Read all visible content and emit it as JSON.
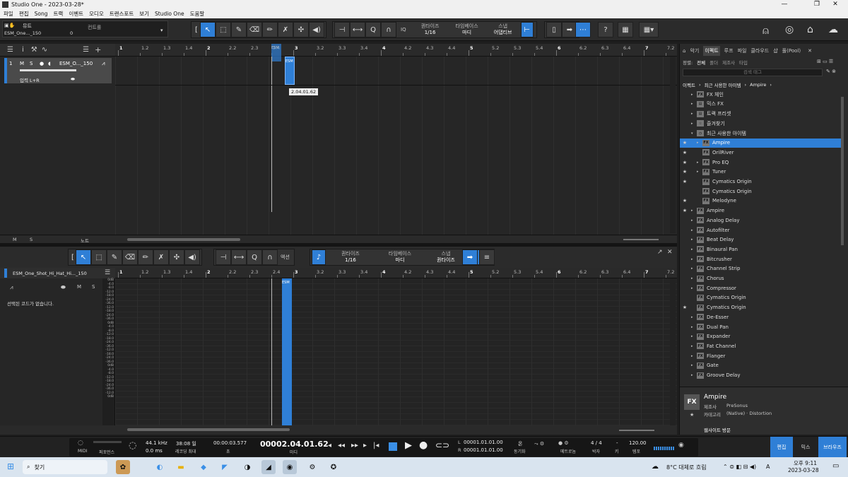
{
  "window": {
    "title": "Studio One - 2023-03-28*",
    "min": "—",
    "max": "❐",
    "close": "✕"
  },
  "menu": [
    "파일",
    "편집",
    "Song",
    "트랙",
    "이벤트",
    "오디오",
    "트랜스포트",
    "보기",
    "Studio One",
    "도움말"
  ],
  "toolbar": {
    "mute_label": "뮤트",
    "track_name": "ESM_One..._150",
    "vol": "0",
    "control_label": "컨트롤",
    "iq": "IQ",
    "quantize_label": "퀀타이즈",
    "quantize_val": "1/16",
    "timebase_label": "타임베이스",
    "timebase_val": "마디",
    "snap_label": "스냅",
    "snap_val": "어댑티브",
    "help": "?"
  },
  "track": {
    "num": "1",
    "m": "M",
    "s": "S",
    "name": "ESM_O..._150",
    "input": "입력 L+R"
  },
  "ruler": [
    "1",
    "1.2",
    "1.3",
    "1.4",
    "2",
    "2.2",
    "2.3",
    "2.4",
    "3",
    "3.2",
    "3.3",
    "3.4",
    "4",
    "4.2",
    "4.3",
    "4.4",
    "5",
    "5.2",
    "5.3",
    "5.4",
    "6",
    "6.2",
    "6.3",
    "6.4",
    "7",
    "7.2"
  ],
  "clip_label": "ESM",
  "tooltip": "2.04.01.62",
  "arr_footer": {
    "m": "M",
    "s": "S",
    "notes": "노트"
  },
  "editor": {
    "action": "액션",
    "quantize_label": "퀀타이즈",
    "quantize_val": "1/16",
    "timebase_label": "타임베이스",
    "timebase_val": "마디",
    "snap_label": "스냅",
    "snap_val": "퀀타이즈",
    "track_name": "ESM_One_Shot_Hi_Hat_Hi..._150",
    "no_code": "선택된 코드가 없습니다.",
    "m": "M",
    "s": "S"
  },
  "vel_scale": [
    "0dB",
    "-4.0",
    "-8.0",
    "-12.0",
    "-18.0",
    "-24.0",
    "-36.0",
    "-12.0",
    "-18.0",
    "-24.0",
    "-36.0",
    "0dB",
    "-4.0",
    "-8.0",
    "-12.0",
    "-18.0",
    "-24.0",
    "-36.0",
    "-12.0",
    "-18.0",
    "-24.0",
    "-36.0",
    "0dB",
    "-4.0",
    "-8.0",
    "-12.0",
    "-18.0",
    "-24.0",
    "-36.0",
    "-12.0",
    "0dB"
  ],
  "browser": {
    "tabs": [
      "악기",
      "이펙트",
      "루프",
      "파일",
      "클라우드",
      "샵",
      "풀(Pool)"
    ],
    "sort_label": "정렬:",
    "sort_opts": [
      "전체",
      "폴더",
      "제조사",
      "타입"
    ],
    "search_placeholder": "검색 태그",
    "crumbs": [
      "이펙트",
      "최근 사용한 아이템",
      "Ampire"
    ],
    "items": [
      {
        "star": "",
        "tri": "▸",
        "icon": "FX",
        "label": "FX 체인",
        "indent": 1
      },
      {
        "star": "",
        "tri": "▸",
        "icon": "▤",
        "label": "믹스 FX",
        "indent": 1
      },
      {
        "star": "",
        "tri": "▸",
        "icon": "▤",
        "label": "트랙 프리셋",
        "indent": 1
      },
      {
        "star": "",
        "tri": "▸",
        "icon": "☆",
        "label": "즐겨찾기",
        "indent": 1
      },
      {
        "star": "",
        "tri": "▾",
        "icon": "◷",
        "label": "최근 사용한 아이템",
        "indent": 1
      },
      {
        "star": "★",
        "tri": "▸",
        "icon": "FX",
        "label": "Ampire",
        "indent": 2,
        "sel": true
      },
      {
        "star": "★",
        "tri": "",
        "icon": "FX",
        "label": "OrilRiver",
        "indent": 2
      },
      {
        "star": "★",
        "tri": "▸",
        "icon": "FX",
        "label": "Pro EQ",
        "indent": 2
      },
      {
        "star": "★",
        "tri": "▸",
        "icon": "FX",
        "label": "Tuner",
        "indent": 2
      },
      {
        "star": "★",
        "tri": "",
        "icon": "FX",
        "label": "Cymatics Origin",
        "indent": 2
      },
      {
        "star": "",
        "tri": "",
        "icon": "FX",
        "label": "Cymatics Origin",
        "indent": 2
      },
      {
        "star": "★",
        "tri": "",
        "icon": "FX",
        "label": "Melodyne",
        "indent": 2
      },
      {
        "star": "★",
        "tri": "▸",
        "icon": "FX",
        "label": "Ampire",
        "indent": 1
      },
      {
        "star": "",
        "tri": "▸",
        "icon": "FX",
        "label": "Analog Delay",
        "indent": 1
      },
      {
        "star": "",
        "tri": "▸",
        "icon": "FX",
        "label": "Autofilter",
        "indent": 1
      },
      {
        "star": "",
        "tri": "▸",
        "icon": "FX",
        "label": "Beat Delay",
        "indent": 1
      },
      {
        "star": "",
        "tri": "▸",
        "icon": "FX",
        "label": "Binaural Pan",
        "indent": 1
      },
      {
        "star": "",
        "tri": "▸",
        "icon": "FX",
        "label": "Bitcrusher",
        "indent": 1
      },
      {
        "star": "",
        "tri": "▸",
        "icon": "FX",
        "label": "Channel Strip",
        "indent": 1
      },
      {
        "star": "",
        "tri": "▸",
        "icon": "FX",
        "label": "Chorus",
        "indent": 1
      },
      {
        "star": "",
        "tri": "▸",
        "icon": "FX",
        "label": "Compressor",
        "indent": 1
      },
      {
        "star": "",
        "tri": "",
        "icon": "FX",
        "label": "Cymatics Origin",
        "indent": 1
      },
      {
        "star": "★",
        "tri": "",
        "icon": "FX",
        "label": "Cymatics Origin",
        "indent": 1
      },
      {
        "star": "",
        "tri": "▸",
        "icon": "FX",
        "label": "De-Esser",
        "indent": 1
      },
      {
        "star": "",
        "tri": "▸",
        "icon": "FX",
        "label": "Dual Pan",
        "indent": 1
      },
      {
        "star": "",
        "tri": "▸",
        "icon": "FX",
        "label": "Expander",
        "indent": 1
      },
      {
        "star": "",
        "tri": "▸",
        "icon": "FX",
        "label": "Fat Channel",
        "indent": 1
      },
      {
        "star": "",
        "tri": "▸",
        "icon": "FX",
        "label": "Flanger",
        "indent": 1
      },
      {
        "star": "",
        "tri": "▸",
        "icon": "FX",
        "label": "Gate",
        "indent": 1
      },
      {
        "star": "",
        "tri": "▸",
        "icon": "FX",
        "label": "Groove Delay",
        "indent": 1
      }
    ],
    "info": {
      "name": "Ampire",
      "maker_label": "제조사",
      "maker": "PreSonus",
      "cat_label": "카테고리",
      "cat": "(Native) · Distortion",
      "website": "웹사이트 방문"
    }
  },
  "transport": {
    "midi": "MIDI",
    "perf": "퍼포먼스",
    "rate": "44.1 kHz",
    "lat": "0.0 ms",
    "rec_time": "38:08 일",
    "rec_label": "레코딩 최대",
    "sec": "00:00:03.577",
    "sec_label": "초",
    "pos": "00002.04.01.62",
    "pos_label": "마디",
    "L": "00001.01.01.00",
    "R": "00001.01.01.00",
    "sync": "온",
    "sync_label": "동기화",
    "metro_label": "메트로놈",
    "sig": "4 / 4",
    "sig_label": "박자",
    "key": "-",
    "key_label": "키",
    "tempo": "120.00",
    "tempo_label": "템포",
    "edit": "편집",
    "mix": "믹스",
    "browse": "브라우즈"
  },
  "taskbar": {
    "search": "찾기",
    "weather": "8°C 대체로 흐림",
    "lang": "A",
    "time": "오후 9:11",
    "date": "2023-03-28"
  },
  "colors": {
    "accent": "#2f7fd6",
    "bg": "#262626"
  }
}
